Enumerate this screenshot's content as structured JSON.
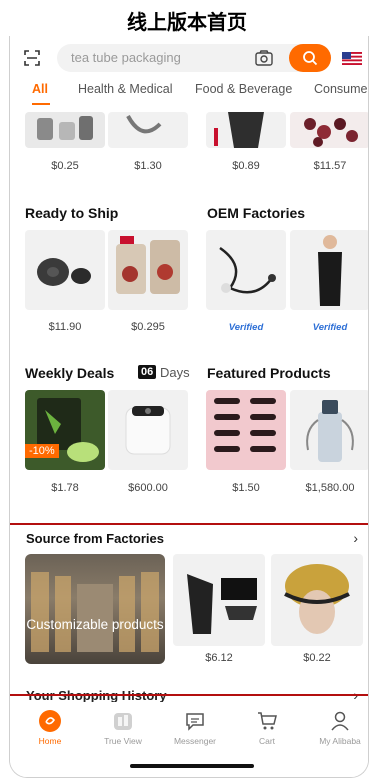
{
  "caption": "线上版本首页",
  "search": {
    "placeholder": "tea tube packaging"
  },
  "tabs": [
    "All",
    "Health & Medical",
    "Food & Beverage",
    "Consumer"
  ],
  "top_row_prices": [
    "$0.25",
    "$1.30",
    "$0.89",
    "$11.57"
  ],
  "ready_to_ship": {
    "title": "Ready to Ship",
    "prices": [
      "$11.90",
      "$0.295"
    ]
  },
  "oem_factories": {
    "title": "OEM Factories",
    "badges": [
      "Verified",
      "Verified"
    ]
  },
  "weekly_deals": {
    "title": "Weekly Deals",
    "days_count": "06",
    "days_label": "Days",
    "discount": "-10%",
    "prices": [
      "$1.78",
      "$600.00"
    ]
  },
  "featured_products": {
    "title": "Featured Products",
    "prices": [
      "$1.50",
      "$1,580.00"
    ]
  },
  "source_factories": {
    "title": "Source from Factories",
    "card_label": "Customizable products",
    "prices": [
      "$6.12",
      "$0.22"
    ]
  },
  "history": {
    "title": "Your Shopping History"
  },
  "nav": [
    {
      "label": "Home",
      "icon": "home-icon"
    },
    {
      "label": "True View",
      "icon": "true-view-icon"
    },
    {
      "label": "Messenger",
      "icon": "messenger-icon"
    },
    {
      "label": "Cart",
      "icon": "cart-icon"
    },
    {
      "label": "My Alibaba",
      "icon": "profile-icon"
    }
  ],
  "colors": {
    "accent": "#ff6a00",
    "divider": "#b30f0f",
    "verified": "#2d6fd6"
  }
}
